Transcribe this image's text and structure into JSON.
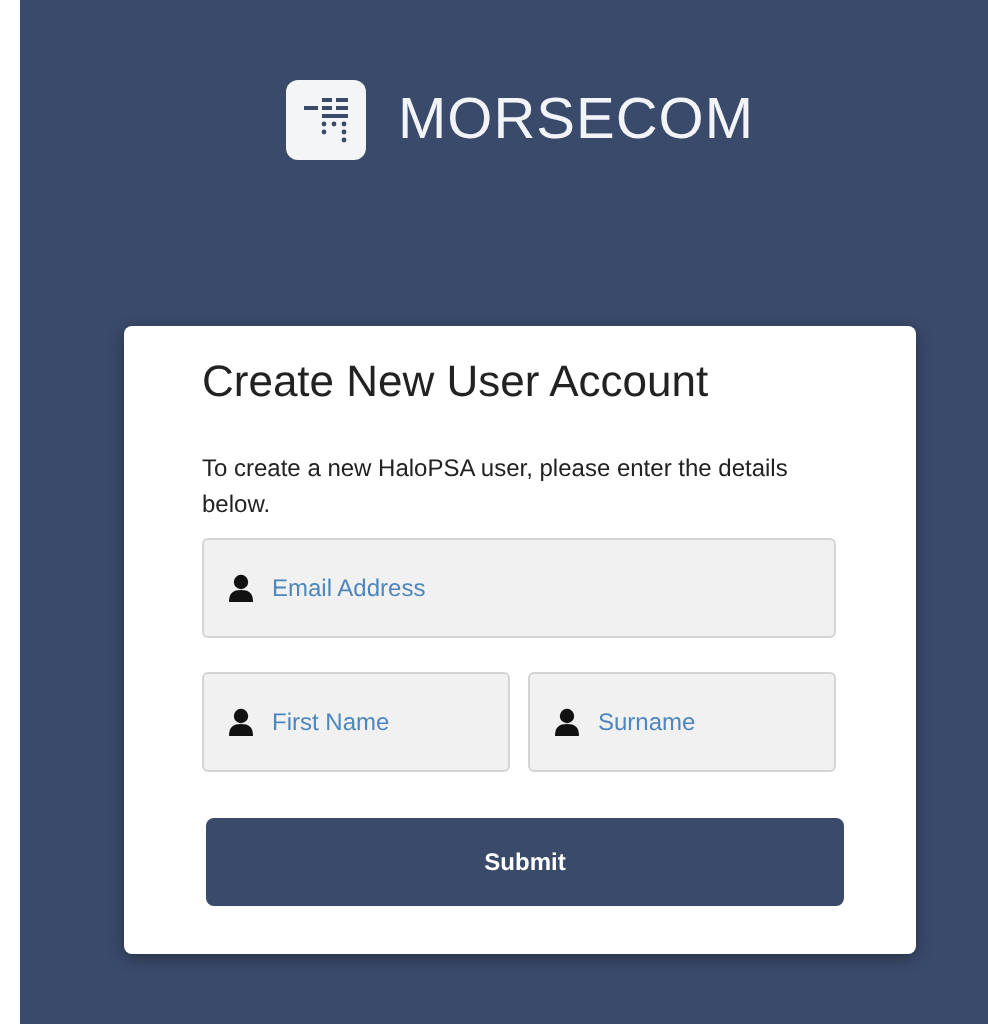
{
  "brand": {
    "name": "MORSECOM"
  },
  "form": {
    "title": "Create New User Account",
    "description": "To create a new HaloPSA user, please enter the details below.",
    "rows": [
      [
        {
          "placeholder": "Email Address"
        }
      ],
      [
        {
          "placeholder": "First Name"
        },
        {
          "placeholder": "Surname"
        }
      ]
    ],
    "submit": "Submit"
  }
}
